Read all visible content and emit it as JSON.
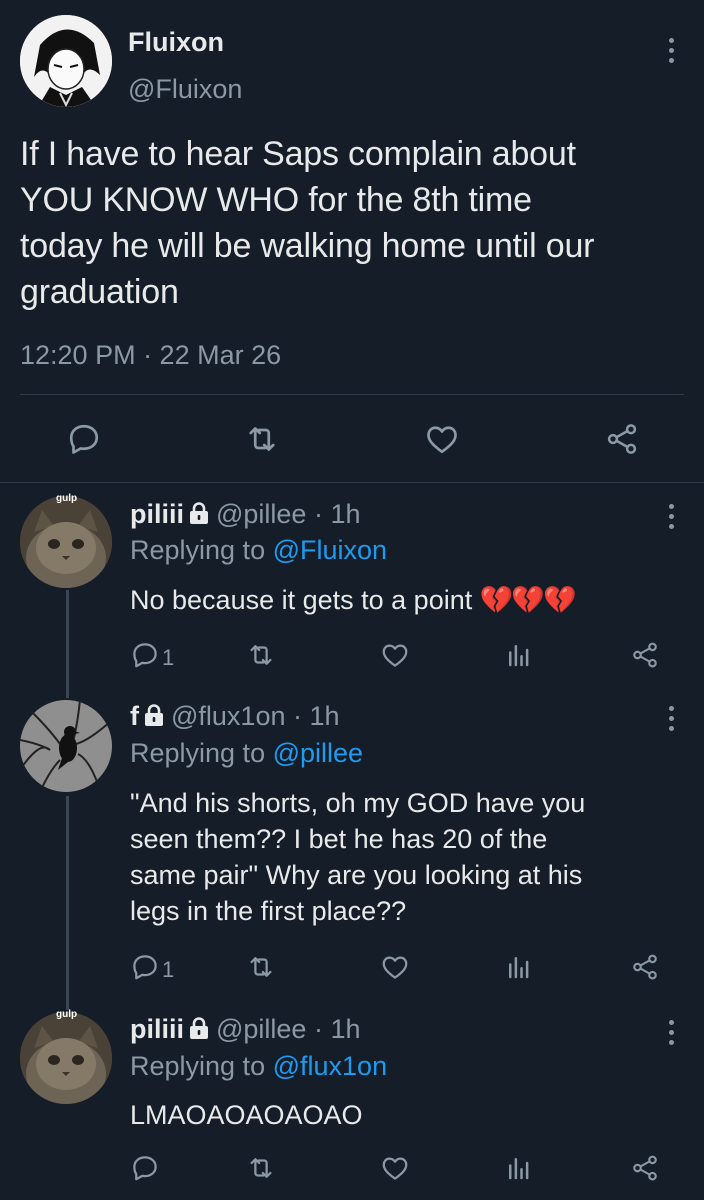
{
  "main_tweet": {
    "display_name": "Fluixon",
    "handle": "@Fluixon",
    "text_lines": [
      "If I have to hear Saps complain about",
      "YOU KNOW WHO for the 8th time",
      "today he will be walking home until our",
      "graduation"
    ],
    "timestamp": "12:20 PM · 22 Mar 26"
  },
  "replies": [
    {
      "display_name": "piliii",
      "handle": "@pillee",
      "time": "· 1h",
      "replying_prefix": "Replying to",
      "replying_to": "@Fluixon",
      "text_lines": [
        "No because it gets to a point"
      ],
      "emoji": "💔💔💔",
      "reply_count": "1",
      "avatar_caption": "gulp"
    },
    {
      "display_name": "f",
      "handle": "@flux1on",
      "time": "· 1h",
      "replying_prefix": "Replying to",
      "replying_to": "@pillee",
      "text_lines": [
        "\"And his shorts, oh my GOD have you",
        "seen them?? I bet he has 20 of the",
        "same pair\" Why are you looking at his",
        "legs in the first place??"
      ],
      "reply_count": "1"
    },
    {
      "display_name": "piliii",
      "handle": "@pillee",
      "time": "· 1h",
      "replying_prefix": "Replying to",
      "replying_to": "@flux1on",
      "text_lines": [
        "LMAOAOAOAOAO"
      ],
      "reply_count": "",
      "avatar_caption": "gulp"
    }
  ],
  "colors": {
    "background": "#151d28",
    "text": "#e7e9ea",
    "muted": "#8b98a5",
    "link": "#1d9bf0",
    "divider": "#2f3b47"
  }
}
